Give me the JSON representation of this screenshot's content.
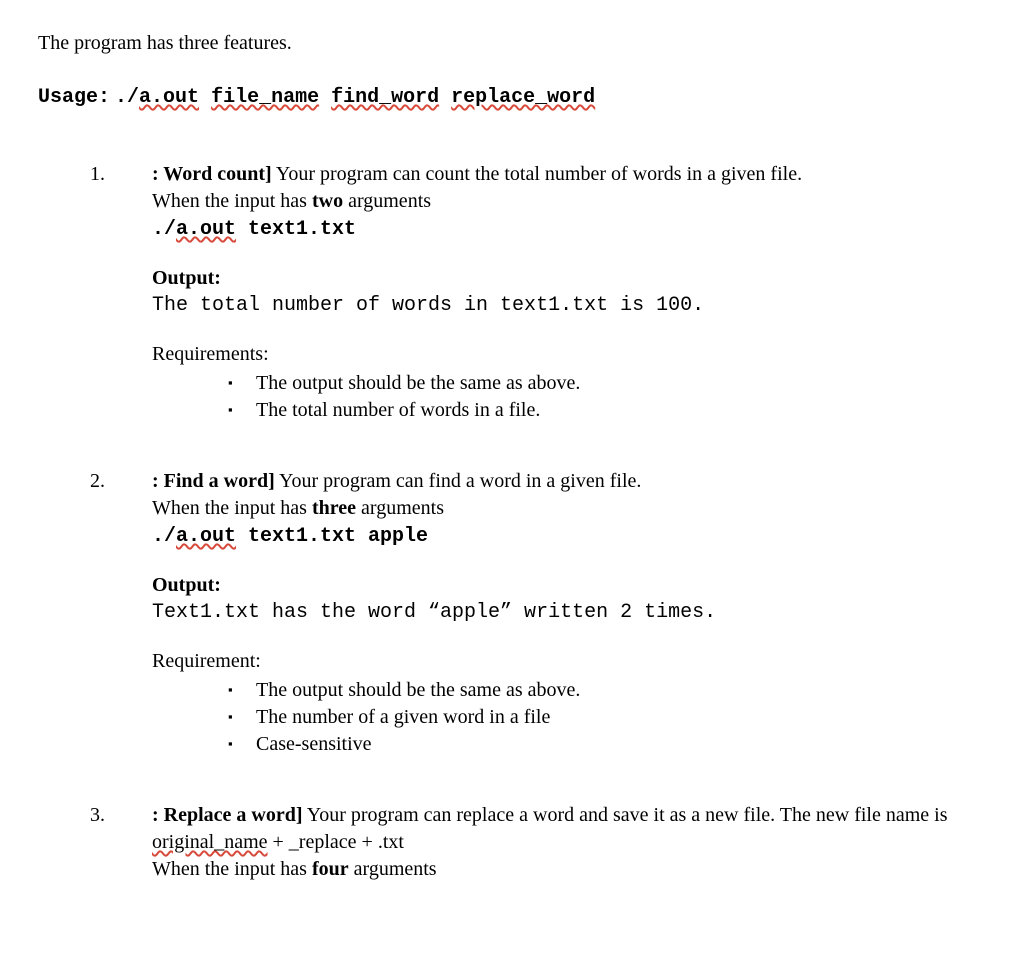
{
  "intro": "The program has three features.",
  "usage": {
    "label": "Usage:",
    "prefix": "./",
    "cmd": "a.out",
    "arg1": "file_name",
    "arg2": "find_word",
    "arg3": "replace_word"
  },
  "f1": {
    "title": ": Word count]",
    "desc": " Your program can count the total number of words in a given file.",
    "args_pre": "When the input has ",
    "args_bold": "two",
    "args_post": " arguments",
    "cmd_prefix": "./",
    "cmd": "a.out",
    "cmd_rest": " text1.txt",
    "output_label": "Output:",
    "output_text": "The total number of words in text1.txt is 100.",
    "req_label": "Requirements:",
    "req1": "The output should be the same as above.",
    "req2": "The total number of words in a file."
  },
  "f2": {
    "title": ": Find a word]",
    "desc": " Your program can find a word in a given file.",
    "args_pre": "When the input has ",
    "args_bold": "three",
    "args_post": " arguments",
    "cmd_prefix": "./",
    "cmd": "a.out",
    "cmd_rest": " text1.txt apple",
    "output_label": "Output:",
    "output_text": "Text1.txt has the word “apple” written 2 times.",
    "req_label": "Requirement:",
    "req1": "The output should be the same as above.",
    "req2": "The number of a given word in a file",
    "req3": "Case-sensitive"
  },
  "f3": {
    "title": ": Replace a word]",
    "desc": " Your program can replace a word and save it as a new file. The new file name is ",
    "filename_sq": "original_name",
    "filename_rest": " + _replace + .txt",
    "args_pre": "When the input has ",
    "args_bold": "four",
    "args_post": " arguments"
  }
}
